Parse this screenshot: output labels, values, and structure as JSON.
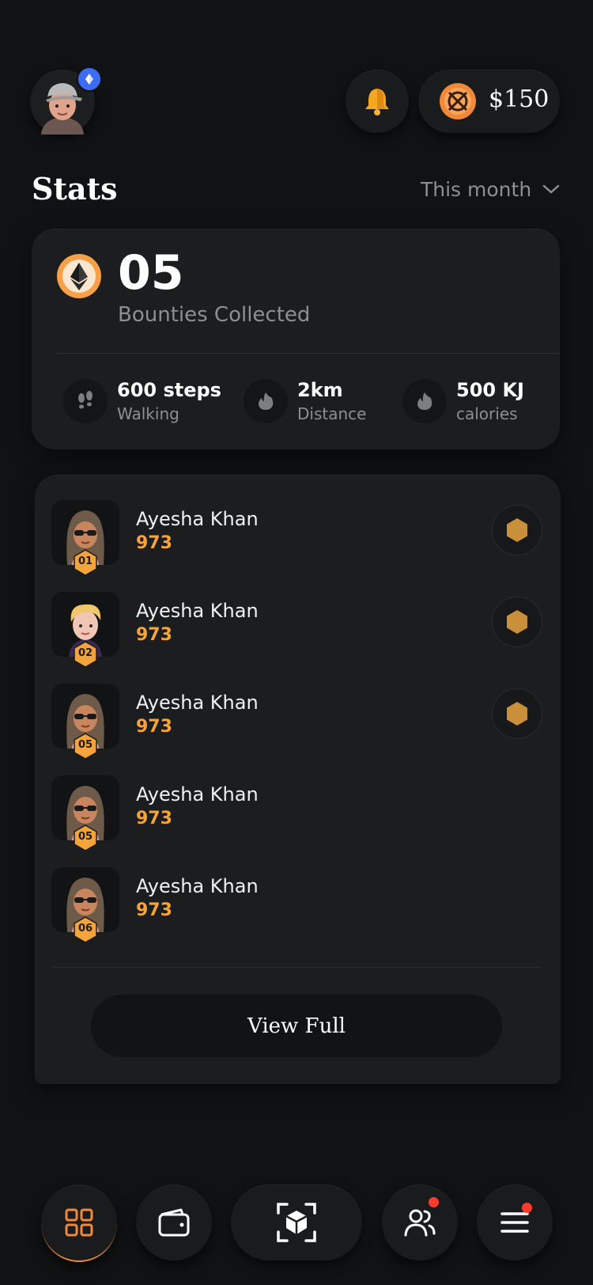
{
  "header": {
    "balance": "$150"
  },
  "stats": {
    "title": "Stats",
    "period": "This month",
    "bounties_count": "05",
    "bounties_label": "Bounties Collected",
    "items": [
      {
        "value": "600 steps",
        "label": "Walking",
        "icon": "footsteps-icon"
      },
      {
        "value": "2km",
        "label": "Distance",
        "icon": "flame-icon"
      },
      {
        "value": "500 KJ",
        "label": "calories",
        "icon": "flame-icon"
      }
    ]
  },
  "leaderboard": {
    "rows": [
      {
        "name": "Ayesha Khan",
        "score": "973",
        "rank": "01",
        "medal": true,
        "avatar": "hijab"
      },
      {
        "name": "Ayesha Khan",
        "score": "973",
        "rank": "02",
        "medal": true,
        "avatar": "blonde"
      },
      {
        "name": "Ayesha Khan",
        "score": "973",
        "rank": "05",
        "medal": true,
        "avatar": "hijab"
      },
      {
        "name": "Ayesha Khan",
        "score": "973",
        "rank": "05",
        "medal": false,
        "avatar": "hijab"
      },
      {
        "name": "Ayesha Khan",
        "score": "973",
        "rank": "06",
        "medal": false,
        "avatar": "hijab"
      }
    ],
    "view_full_label": "View Full"
  },
  "nav": {
    "items": [
      "dashboard-icon",
      "wallet-icon",
      "ar-cube-icon",
      "friends-icon",
      "menu-icon"
    ]
  },
  "colors": {
    "accent": "#f5a33b",
    "background": "#111214",
    "card": "#1c1d1e",
    "badge_red": "#ff3b30",
    "verified_blue": "#3b6cf2"
  }
}
